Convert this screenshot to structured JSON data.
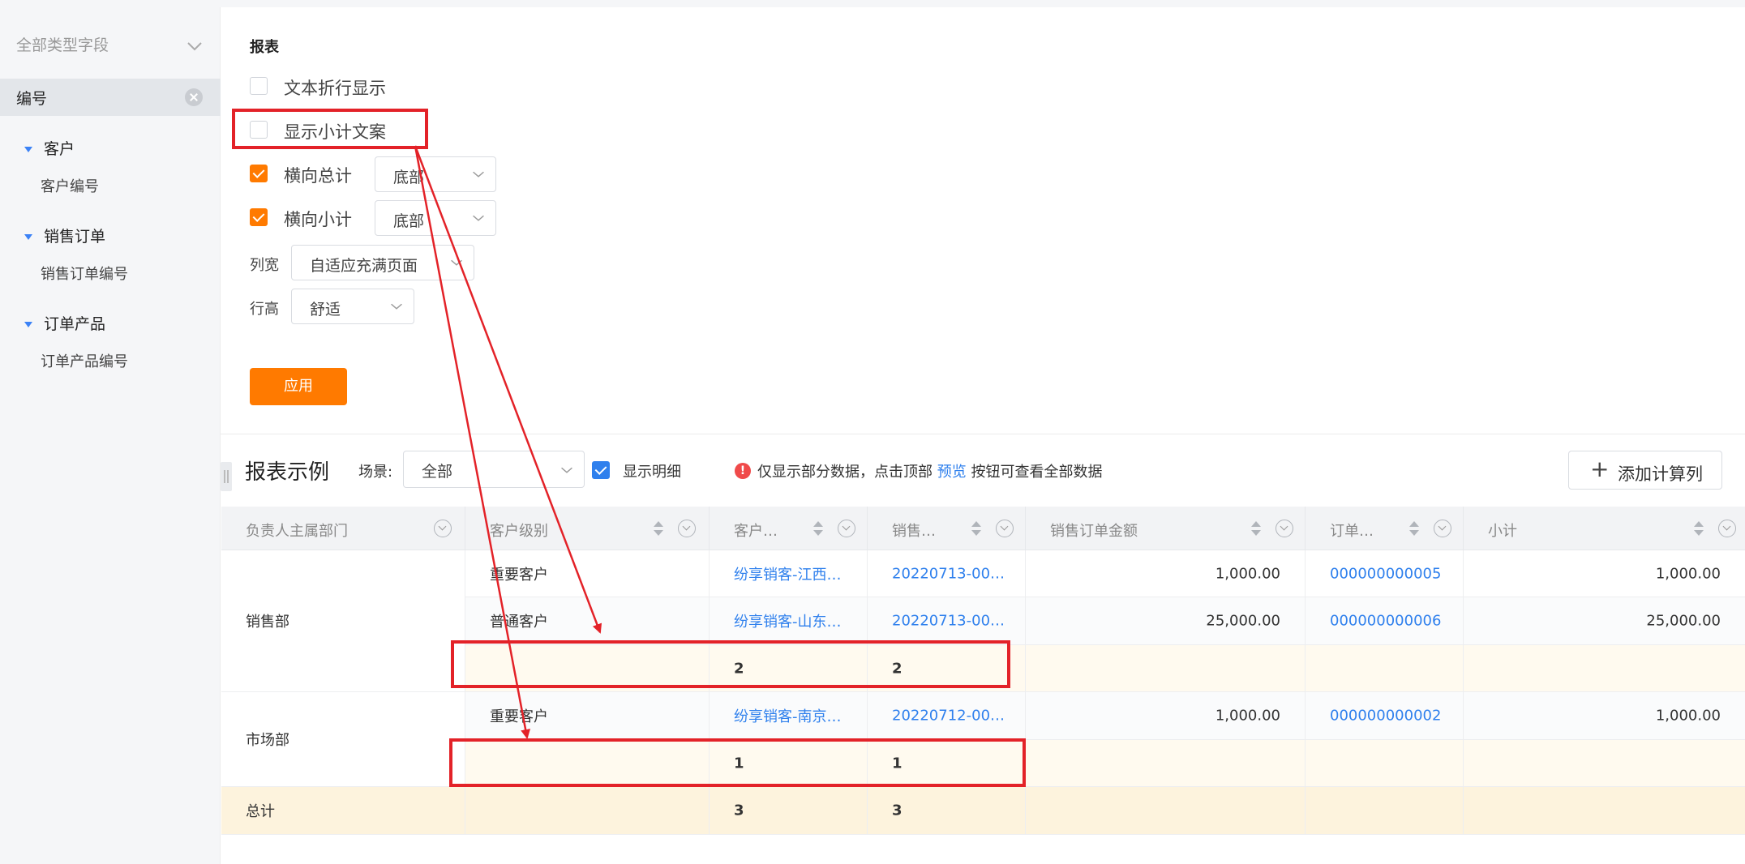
{
  "sidebar": {
    "filter_label": "全部类型字段",
    "selected_field": "编号",
    "groups": [
      {
        "name": "客户",
        "child": "客户编号"
      },
      {
        "name": "销售订单",
        "child": "销售订单编号"
      },
      {
        "name": "订单产品",
        "child": "订单产品编号"
      }
    ]
  },
  "settings": {
    "title": "报表",
    "wrap_text_label": "文本折行显示",
    "wrap_text_checked": false,
    "subtotal_text_label": "显示小计文案",
    "subtotal_text_checked": false,
    "h_total_label": "横向总计",
    "h_total_checked": true,
    "h_total_position": "底部",
    "h_subtotal_label": "横向小计",
    "h_subtotal_checked": true,
    "h_subtotal_position": "底部",
    "col_width_label": "列宽",
    "col_width_value": "自适应充满页面",
    "row_height_label": "行高",
    "row_height_value": "舒适",
    "apply_label": "应用"
  },
  "example": {
    "title": "报表示例",
    "scene_label": "场景:",
    "scene_value": "全部",
    "show_detail_label": "显示明细",
    "show_detail_checked": true,
    "info_prefix": "仅显示部分数据，点击顶部",
    "info_link": "预览",
    "info_suffix": "按钮可查看全部数据",
    "add_calc_label": "添加计算列"
  },
  "table": {
    "headers": [
      "负责人主属部门",
      "客户级别",
      "客户…",
      "销售…",
      "销售订单金额",
      "订单…",
      "小计"
    ],
    "groups": [
      {
        "dept": "销售部",
        "rows": [
          {
            "level": "重要客户",
            "customer": "纷享销客-江西…",
            "order": "20220713-00…",
            "amount": "1,000.00",
            "product": "000000000005",
            "subtotal": "1,000.00"
          },
          {
            "level": "普通客户",
            "customer": "纷享销客-山东…",
            "order": "20220713-00…",
            "amount": "25,000.00",
            "product": "000000000006",
            "subtotal": "25,000.00"
          }
        ],
        "sub_customer": "2",
        "sub_order": "2"
      },
      {
        "dept": "市场部",
        "rows": [
          {
            "level": "重要客户",
            "customer": "纷享销客-南京…",
            "order": "20220712-00…",
            "amount": "1,000.00",
            "product": "000000000002",
            "subtotal": "1,000.00"
          }
        ],
        "sub_customer": "1",
        "sub_order": "1"
      }
    ],
    "total_label": "总计",
    "total_customer": "3",
    "total_order": "3"
  },
  "colors": {
    "accent_orange": "#ff7a00",
    "link_blue": "#2f80ed",
    "annotation_red": "#e32228"
  }
}
